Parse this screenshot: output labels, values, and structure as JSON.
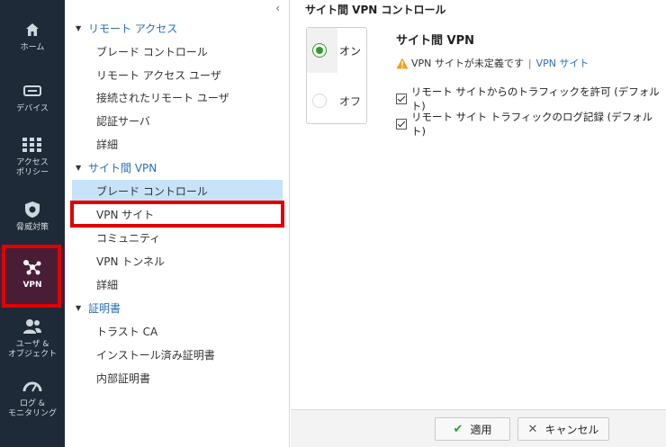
{
  "rail": {
    "items": [
      {
        "label": "ホーム",
        "icon": "home-icon"
      },
      {
        "label": "デバイス",
        "icon": "device-icon"
      },
      {
        "label": "アクセス\nポリシー",
        "icon": "grid-icon"
      },
      {
        "label": "脅威対策",
        "icon": "shield-icon"
      },
      {
        "label": "VPN",
        "icon": "vpn-nodes-icon"
      },
      {
        "label": "ユーザ &\nオブジェクト",
        "icon": "users-icon"
      },
      {
        "label": "ログ &\nモニタリング",
        "icon": "gauge-icon"
      }
    ]
  },
  "tree": {
    "collapse_glyph": "‹",
    "groups": [
      {
        "label": "リモート アクセス",
        "items": [
          "ブレード コントロール",
          "リモート アクセス ユーザ",
          "接続されたリモート ユーザ",
          "認証サーバ",
          "詳細"
        ]
      },
      {
        "label": "サイト間 VPN",
        "items": [
          "ブレード コントロール",
          "VPN サイト",
          "コミュニティ",
          "VPN トンネル",
          "詳細"
        ]
      },
      {
        "label": "証明書",
        "items": [
          "トラスト CA",
          "インストール済み証明書",
          "内部証明書"
        ]
      }
    ]
  },
  "main": {
    "title": "サイト間 VPN コントロール",
    "toggle": {
      "on_label": "オン",
      "off_label": "オフ"
    },
    "section_title": "サイト間 VPN",
    "warning_text": "VPN サイトが未定義です",
    "warning_sep": "|",
    "warning_link": "VPN サイト",
    "checkbox1": "リモート サイトからのトラフィックを許可 (デフォルト)",
    "checkbox2": "リモート サイト トラフィックのログ記録 (デフォルト)"
  },
  "footer": {
    "apply": "適用",
    "cancel": "キャンセル"
  },
  "colors": {
    "rail_bg": "#1e2a38",
    "rail_active": "#4a1d36",
    "highlight_red": "#e00000",
    "selected_bg": "#c6e3f9",
    "link": "#2a6fb5",
    "radio_green": "#2e9b2e"
  }
}
